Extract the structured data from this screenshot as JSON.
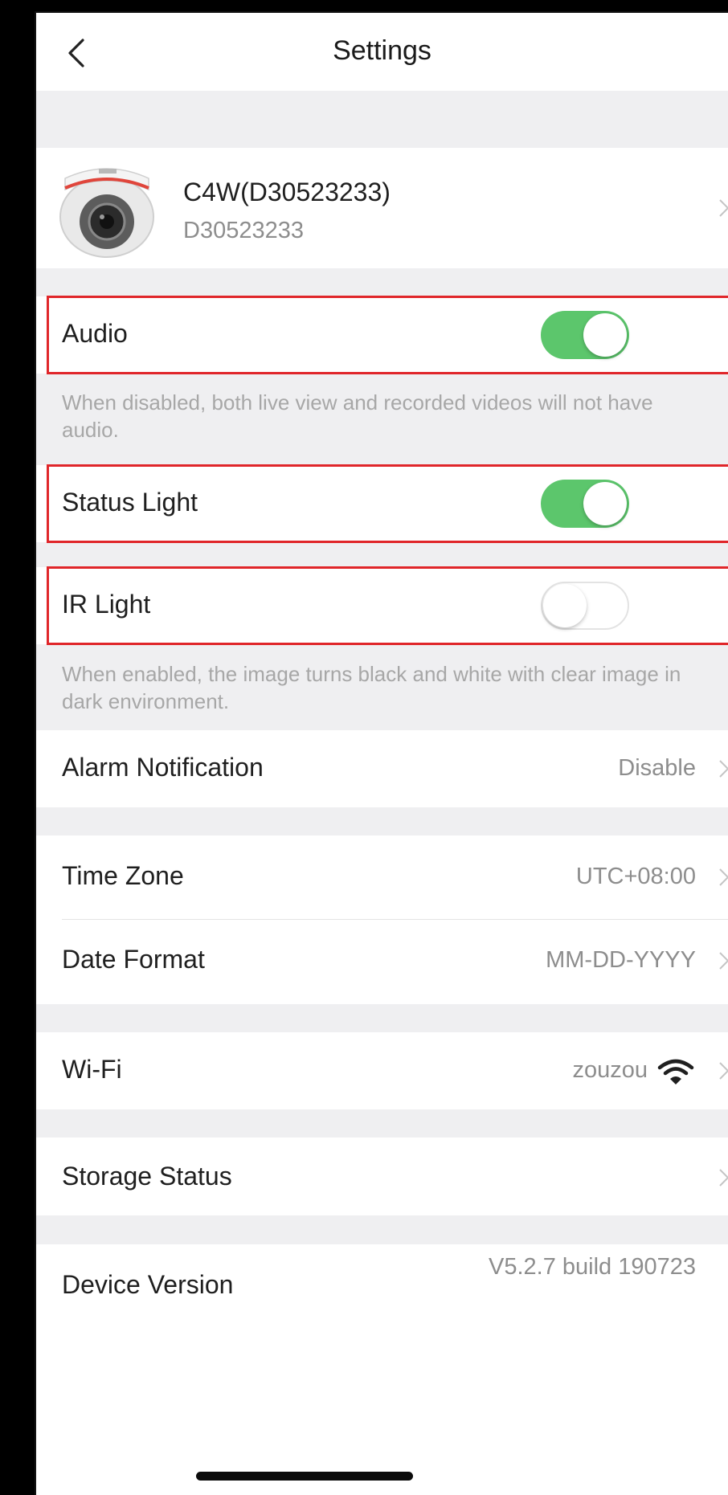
{
  "header": {
    "title": "Settings"
  },
  "device": {
    "name": "C4W(D30523233)",
    "serial": "D30523233"
  },
  "audio": {
    "label": "Audio",
    "enabled": true,
    "note": "When disabled, both live view and recorded videos will not have audio."
  },
  "status_light": {
    "label": "Status Light",
    "enabled": true
  },
  "ir_light": {
    "label": "IR Light",
    "enabled": false,
    "note": "When enabled, the image turns black and white with clear image in dark environment."
  },
  "alarm": {
    "label": "Alarm Notification",
    "value": "Disable"
  },
  "time_zone": {
    "label": "Time Zone",
    "value": "UTC+08:00"
  },
  "date_format": {
    "label": "Date Format",
    "value": "MM-DD-YYYY"
  },
  "wifi": {
    "label": "Wi-Fi",
    "value": "zouzou"
  },
  "storage": {
    "label": "Storage Status"
  },
  "version": {
    "label": "Device Version",
    "value": "V5.2.7 build 190723"
  },
  "colors": {
    "toggle_on": "#5cc66c",
    "highlight": "#e0262a",
    "background": "#efeff1"
  }
}
